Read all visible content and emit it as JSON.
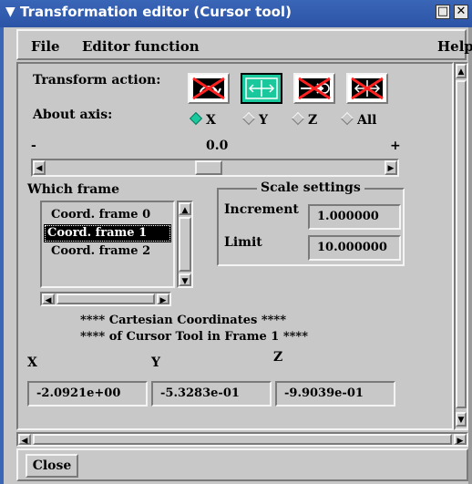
{
  "window": {
    "title": "Transformation editor (Cursor tool)",
    "menu_icon": "chevron-down-icon",
    "buttons": [
      "minimize-icon",
      "close-icon"
    ]
  },
  "menubar": {
    "file": "File",
    "editor_function": "Editor function",
    "help": "Help"
  },
  "transform_action": {
    "label": "Transform action:",
    "buttons": [
      {
        "name": "rotate",
        "icon": "rotate-action-icon",
        "active": false
      },
      {
        "name": "translate",
        "icon": "translate-action-icon",
        "active": true
      },
      {
        "name": "scale-axis",
        "icon": "scale-axis-action-icon",
        "active": false
      },
      {
        "name": "scale-all",
        "icon": "scale-all-action-icon",
        "active": false
      }
    ]
  },
  "about_axis": {
    "label": "About axis:",
    "options": [
      {
        "label": "X",
        "selected": true
      },
      {
        "label": "Y",
        "selected": false
      },
      {
        "label": "Z",
        "selected": false
      },
      {
        "label": "All",
        "selected": false
      }
    ]
  },
  "slider": {
    "min_label": "-",
    "value": "0.0",
    "max_label": "+",
    "fraction": 0.5
  },
  "which_frame": {
    "label": "Which frame",
    "items": [
      "Coord. frame 0",
      "Coord. frame 1",
      "Coord. frame 2"
    ],
    "selected_index": 1
  },
  "scale_settings": {
    "title": "Scale settings",
    "increment_label": "Increment",
    "increment_value": "1.000000",
    "limit_label": "Limit",
    "limit_value": "10.000000"
  },
  "coords": {
    "line1": "**** Cartesian Coordinates ****",
    "line2": "**** of Cursor Tool in Frame 1 ****",
    "x_label": "X",
    "y_label": "Y",
    "z_label": "Z",
    "x_value": "-2.0921e+00",
    "y_value": "-5.3283e-01",
    "z_value": "-9.9039e-01"
  },
  "footer": {
    "close_label": "Close"
  },
  "colors": {
    "title_bg": "#2c54a6",
    "accent_green": "#19c89c",
    "icon_red": "#ff2020",
    "window_bg": "#c8c8c8"
  }
}
